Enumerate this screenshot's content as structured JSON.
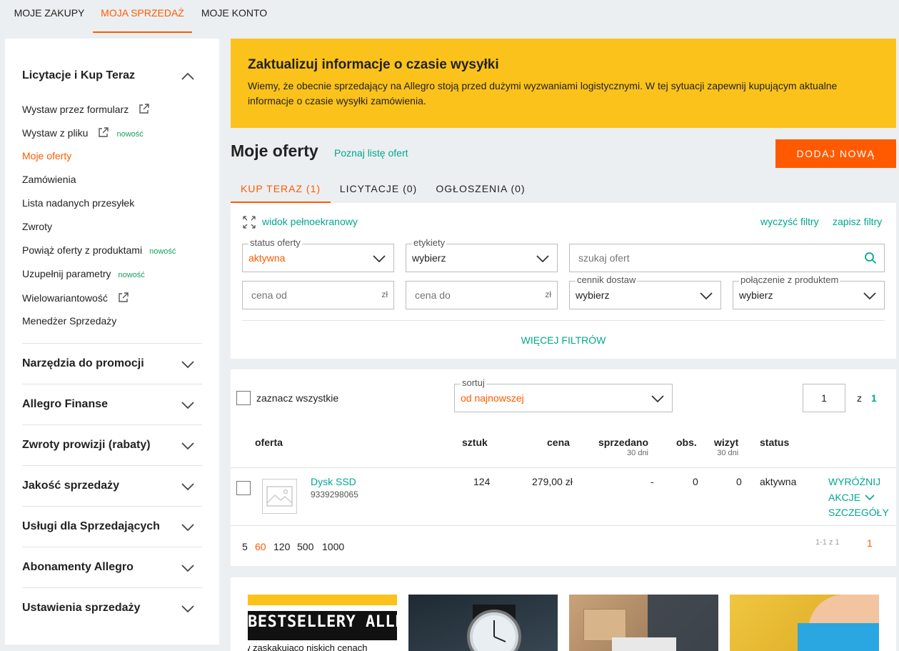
{
  "topnav": [
    "MOJE ZAKUPY",
    "MOJA SPRZEDAŻ",
    "MOJE KONTO"
  ],
  "sidebar": {
    "section_open": "Licytacje i Kup Teraz",
    "items": [
      {
        "label": "Wystaw przez formularz",
        "badge": "",
        "external": true
      },
      {
        "label": "Wystaw z pliku",
        "badge": "nowość",
        "external": true
      },
      {
        "label": "Moje oferty",
        "badge": "",
        "active": true
      },
      {
        "label": "Zamówienia",
        "badge": ""
      },
      {
        "label": "Lista nadanych przesyłek",
        "badge": ""
      },
      {
        "label": "Zwroty",
        "badge": ""
      },
      {
        "label": "Powiąż oferty z produktami",
        "badge": "nowość"
      },
      {
        "label": "Uzupełnij parametry",
        "badge": "nowość"
      },
      {
        "label": "Wielowariantowość",
        "badge": "",
        "external": true
      },
      {
        "label": "Menedżer Sprzedaży",
        "badge": ""
      }
    ],
    "sections": [
      "Narzędzia do promocji",
      "Allegro Finanse",
      "Zwroty prowizji (rabaty)",
      "Jakość sprzedaży",
      "Usługi dla Sprzedających",
      "Abonamenty Allegro",
      "Ustawienia sprzedaży"
    ]
  },
  "banner": {
    "title": "Zaktualizuj informacje o czasie wysyłki",
    "text": "Wiemy, że obecnie sprzedający na Allegro stoją przed dużymi wyzwaniami logistycznymi. W tej sytuacji zapewnij kupującym aktualne informacje o czasie wysyłki zamówienia."
  },
  "page": {
    "title": "Moje oferty",
    "link": "Poznaj listę ofert",
    "add_button": "DODAJ NOWĄ"
  },
  "offer_tabs": [
    "KUP TERAZ (1)",
    "LICYTACJE (0)",
    "OGŁOSZENIA (0)"
  ],
  "filters": {
    "fullscreen": "widok pełnoekranowy",
    "clear": "wyczyść filtry",
    "save": "zapisz filtry",
    "status_label": "status oferty",
    "status_value": "aktywna",
    "tags_label": "etykiety",
    "tags_value": "wybierz",
    "search_placeholder": "szukaj ofert",
    "price_from_placeholder": "cena od",
    "price_to_placeholder": "cena do",
    "currency": "zł",
    "shipping_label": "cennik dostaw",
    "shipping_value": "wybierz",
    "product_label": "połączenie z produktem",
    "product_value": "wybierz",
    "more": "WIĘCEJ FILTRÓW"
  },
  "results": {
    "select_all": "zaznacz wszystkie",
    "sort_label": "sortuj",
    "sort_value": "od najnowszej",
    "page_current": "1",
    "page_of": "z",
    "page_total": "1",
    "headers": {
      "offer": "oferta",
      "qty": "sztuk",
      "price": "cena",
      "sold": "sprzedano",
      "sold_sub": "30 dni",
      "obs": "obs.",
      "visits": "wizyt",
      "visits_sub": "30 dni",
      "status": "status"
    },
    "row": {
      "name": "Dysk SSD",
      "id": "9339298065",
      "qty": "124",
      "price": "279,00 zł",
      "sold": "-",
      "obs": "0",
      "visits": "0",
      "status": "aktywna",
      "actions": [
        "WYRÓŻNIJ",
        "AKCJE",
        "SZCZEGÓŁY"
      ]
    },
    "page_sizes": [
      "5",
      "60",
      "120",
      "500",
      "1000"
    ],
    "active_page_size": "60",
    "range": "1-1 z 1",
    "page_link": "1"
  },
  "promo": {
    "card1_text": "BESTSELLERY ALLEGRO",
    "card1_sub": "w zaskakująco niskich cenach"
  },
  "colors": {
    "accent": "#ff5a00",
    "link": "#00a790",
    "banner": "#fbc21b",
    "badge": "#1a9c5c"
  }
}
